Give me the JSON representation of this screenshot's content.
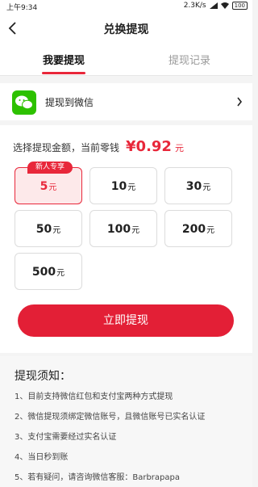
{
  "status_bar": {
    "time": "上午9:34",
    "network": "2.3K/s",
    "battery": "100"
  },
  "nav": {
    "title": "兑换提现"
  },
  "tabs": [
    {
      "label": "我要提现"
    },
    {
      "label": "提现记录"
    }
  ],
  "method": {
    "label": "提现到微信"
  },
  "amount": {
    "prompt": "选择提现金额，当前零钱",
    "value": "¥0.92",
    "unit": "元"
  },
  "options": [
    {
      "amount": "5",
      "unit": "元",
      "badge": "新人专享",
      "selected": true
    },
    {
      "amount": "10",
      "unit": "元"
    },
    {
      "amount": "30",
      "unit": "元"
    },
    {
      "amount": "50",
      "unit": "元"
    },
    {
      "amount": "100",
      "unit": "元"
    },
    {
      "amount": "200",
      "unit": "元"
    },
    {
      "amount": "500",
      "unit": "元"
    }
  ],
  "submit_button": {
    "label": "立即提现"
  },
  "notice": {
    "title": "提现须知：",
    "items": [
      "1、目前支持微信红包和支付宝两种方式提现",
      "2、微信提现须绑定微信账号，且微信账号已实名认证",
      "3、支付宝需要经过实名认证",
      "4、当日秒到账",
      "5、若有疑问，请咨询微信客服：Barbrapapa"
    ]
  },
  "colors": {
    "accent": "#e8273a",
    "wechat_green": "#2dc100"
  }
}
